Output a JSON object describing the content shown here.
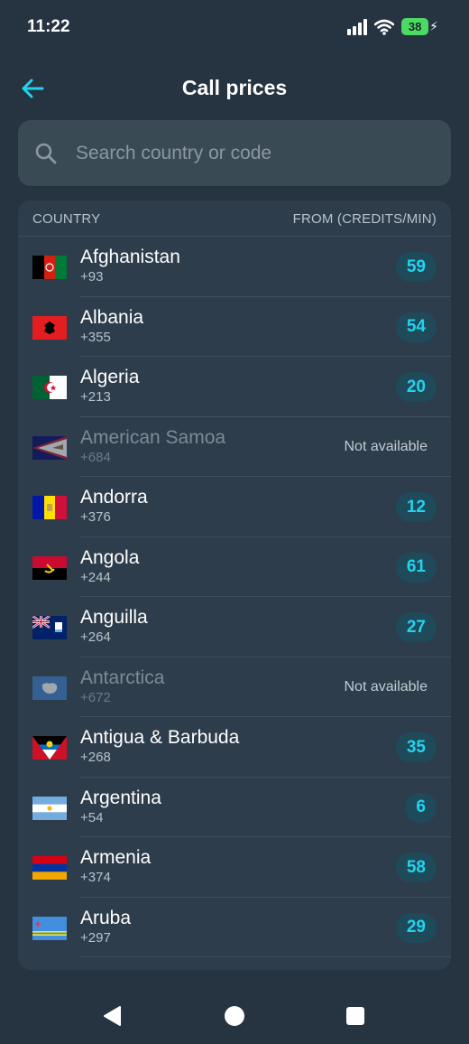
{
  "status_bar": {
    "time": "11:22",
    "battery": "38"
  },
  "header": {
    "title": "Call prices"
  },
  "search": {
    "placeholder": "Search country or code"
  },
  "table": {
    "col_country": "COUNTRY",
    "col_price": "FROM (CREDITS/MIN)",
    "rows": [
      {
        "name": "Afghanistan",
        "code": "+93",
        "price": "59",
        "flag": "af-flag"
      },
      {
        "name": "Albania",
        "code": "+355",
        "price": "54",
        "flag": "al-flag"
      },
      {
        "name": "Algeria",
        "code": "+213",
        "price": "20",
        "flag": "dz-flag"
      },
      {
        "name": "American Samoa",
        "code": "+684",
        "status": "Not available",
        "flag": "as-flag"
      },
      {
        "name": "Andorra",
        "code": "+376",
        "price": "12",
        "flag": "ad-flag"
      },
      {
        "name": "Angola",
        "code": "+244",
        "price": "61",
        "flag": "ao-flag"
      },
      {
        "name": "Anguilla",
        "code": "+264",
        "price": "27",
        "flag": "ai-flag"
      },
      {
        "name": "Antarctica",
        "code": "+672",
        "status": "Not available",
        "flag": "aq-flag"
      },
      {
        "name": "Antigua & Barbuda",
        "code": "+268",
        "price": "35",
        "flag": "ag-flag"
      },
      {
        "name": "Argentina",
        "code": "+54",
        "price": "6",
        "flag": "ar-flag"
      },
      {
        "name": "Armenia",
        "code": "+374",
        "price": "58",
        "flag": "am-flag"
      },
      {
        "name": "Aruba",
        "code": "+297",
        "price": "29",
        "flag": "aw-flag"
      }
    ]
  },
  "colors": {
    "background": "#263340",
    "card": "#2e3d4c",
    "accent": "#22d3ee",
    "badge": "#1f4a5a"
  },
  "icons": {
    "back": "arrow-left-icon",
    "search": "search-icon",
    "nav": [
      "back-triangle-icon",
      "home-circle-icon",
      "recents-square-icon"
    ]
  }
}
